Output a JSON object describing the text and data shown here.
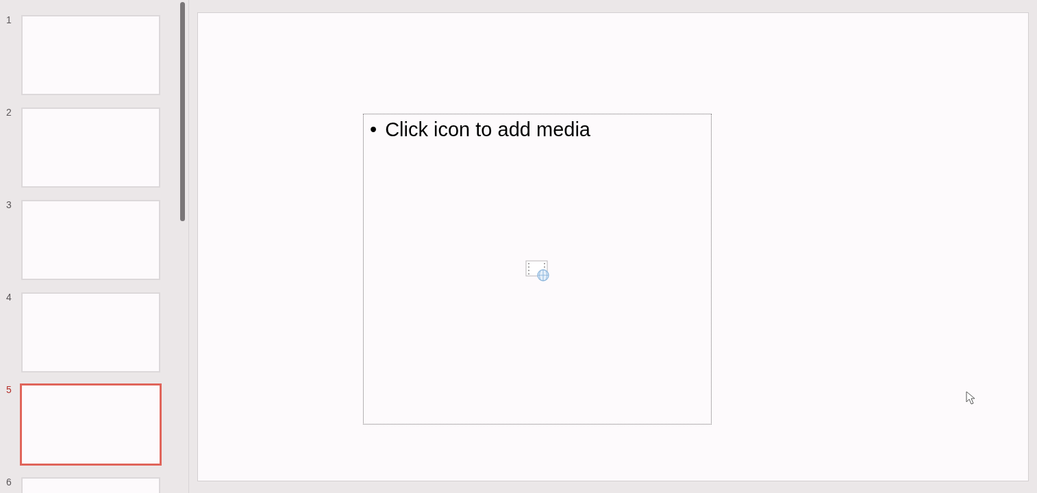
{
  "slides_panel": {
    "slides": [
      {
        "number": "1",
        "selected": false
      },
      {
        "number": "2",
        "selected": false
      },
      {
        "number": "3",
        "selected": false
      },
      {
        "number": "4",
        "selected": false
      },
      {
        "number": "5",
        "selected": true
      },
      {
        "number": "6",
        "selected": false
      }
    ]
  },
  "slide": {
    "placeholder": {
      "bullet": "•",
      "text": "Click icon to add media"
    }
  }
}
